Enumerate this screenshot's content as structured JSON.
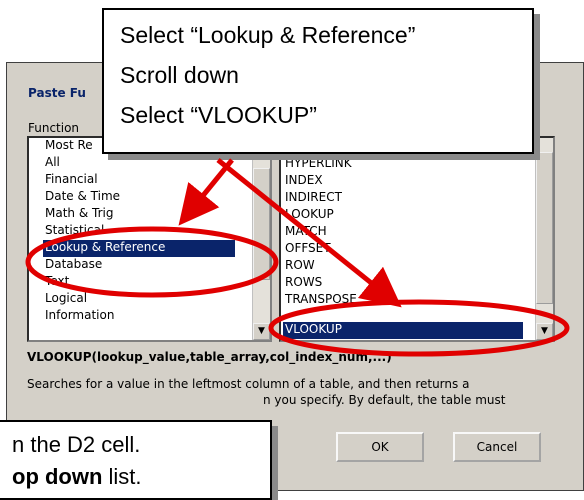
{
  "dialog": {
    "title": "Paste Fu",
    "function_category_label": "Function",
    "categories": [
      "Most Re",
      "All",
      "Financial",
      "Date & Time",
      "Math & Trig",
      "Statistical",
      "Lookup & Reference",
      "Database",
      "Text",
      "Logical",
      "Information"
    ],
    "selected_category": "Lookup & Reference",
    "functions": [
      "HYPERLINK",
      "INDEX",
      "INDIRECT",
      "LOOKUP",
      "MATCH",
      "OFFSET",
      "ROW",
      "ROWS",
      "TRANSPOSE",
      "VLOOKUP"
    ],
    "selected_function": "VLOOKUP",
    "syntax": "VLOOKUP(lookup_value,table_array,col_index_num,...)",
    "description_line1": "Searches for a value in the leftmost column of a table, and then returns a",
    "description_line2": "n you specify. By default, the table must",
    "ok_label": "OK",
    "cancel_label": "Cancel"
  },
  "callout_top": {
    "line1_prefix": "Select “",
    "line1_bold": "Lookup & Reference",
    "line1_suffix": "”",
    "line2": "Scroll down",
    "line3_prefix": "Select “",
    "line3_bold": "VLOOKUP",
    "line3_suffix": "”"
  },
  "callout_bottom": {
    "line1": "n the D2 cell.",
    "line2_bold": "op down",
    "line2_suffix": " list."
  },
  "colors": {
    "selection": "#0a246a",
    "annotation_red": "#e00000",
    "dialog_face": "#d4d0c8"
  }
}
